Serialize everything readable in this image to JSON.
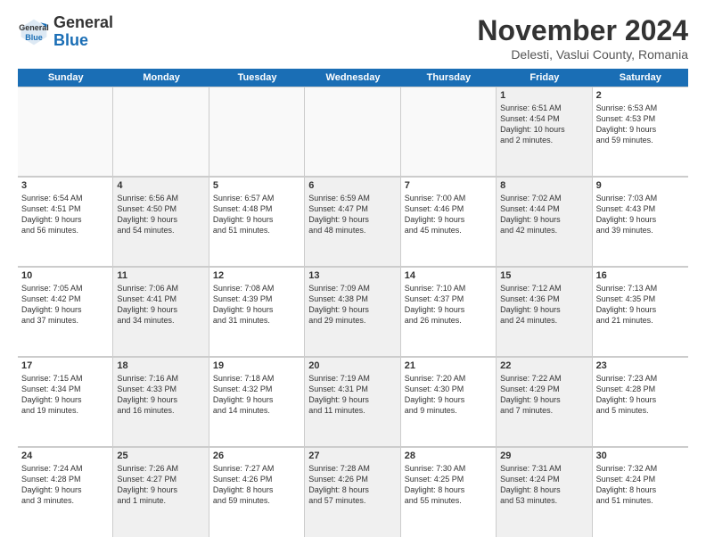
{
  "logo": {
    "line1": "General",
    "line2": "Blue"
  },
  "title": "November 2024",
  "location": "Delesti, Vaslui County, Romania",
  "days_of_week": [
    "Sunday",
    "Monday",
    "Tuesday",
    "Wednesday",
    "Thursday",
    "Friday",
    "Saturday"
  ],
  "weeks": [
    [
      {
        "day": "",
        "info": "",
        "empty": true
      },
      {
        "day": "",
        "info": "",
        "empty": true
      },
      {
        "day": "",
        "info": "",
        "empty": true
      },
      {
        "day": "",
        "info": "",
        "empty": true
      },
      {
        "day": "",
        "info": "",
        "empty": true
      },
      {
        "day": "1",
        "info": "Sunrise: 6:51 AM\nSunset: 4:54 PM\nDaylight: 10 hours\nand 2 minutes.",
        "shaded": true
      },
      {
        "day": "2",
        "info": "Sunrise: 6:53 AM\nSunset: 4:53 PM\nDaylight: 9 hours\nand 59 minutes.",
        "shaded": false
      }
    ],
    [
      {
        "day": "3",
        "info": "Sunrise: 6:54 AM\nSunset: 4:51 PM\nDaylight: 9 hours\nand 56 minutes.",
        "shaded": false
      },
      {
        "day": "4",
        "info": "Sunrise: 6:56 AM\nSunset: 4:50 PM\nDaylight: 9 hours\nand 54 minutes.",
        "shaded": true
      },
      {
        "day": "5",
        "info": "Sunrise: 6:57 AM\nSunset: 4:48 PM\nDaylight: 9 hours\nand 51 minutes.",
        "shaded": false
      },
      {
        "day": "6",
        "info": "Sunrise: 6:59 AM\nSunset: 4:47 PM\nDaylight: 9 hours\nand 48 minutes.",
        "shaded": true
      },
      {
        "day": "7",
        "info": "Sunrise: 7:00 AM\nSunset: 4:46 PM\nDaylight: 9 hours\nand 45 minutes.",
        "shaded": false
      },
      {
        "day": "8",
        "info": "Sunrise: 7:02 AM\nSunset: 4:44 PM\nDaylight: 9 hours\nand 42 minutes.",
        "shaded": true
      },
      {
        "day": "9",
        "info": "Sunrise: 7:03 AM\nSunset: 4:43 PM\nDaylight: 9 hours\nand 39 minutes.",
        "shaded": false
      }
    ],
    [
      {
        "day": "10",
        "info": "Sunrise: 7:05 AM\nSunset: 4:42 PM\nDaylight: 9 hours\nand 37 minutes.",
        "shaded": false
      },
      {
        "day": "11",
        "info": "Sunrise: 7:06 AM\nSunset: 4:41 PM\nDaylight: 9 hours\nand 34 minutes.",
        "shaded": true
      },
      {
        "day": "12",
        "info": "Sunrise: 7:08 AM\nSunset: 4:39 PM\nDaylight: 9 hours\nand 31 minutes.",
        "shaded": false
      },
      {
        "day": "13",
        "info": "Sunrise: 7:09 AM\nSunset: 4:38 PM\nDaylight: 9 hours\nand 29 minutes.",
        "shaded": true
      },
      {
        "day": "14",
        "info": "Sunrise: 7:10 AM\nSunset: 4:37 PM\nDaylight: 9 hours\nand 26 minutes.",
        "shaded": false
      },
      {
        "day": "15",
        "info": "Sunrise: 7:12 AM\nSunset: 4:36 PM\nDaylight: 9 hours\nand 24 minutes.",
        "shaded": true
      },
      {
        "day": "16",
        "info": "Sunrise: 7:13 AM\nSunset: 4:35 PM\nDaylight: 9 hours\nand 21 minutes.",
        "shaded": false
      }
    ],
    [
      {
        "day": "17",
        "info": "Sunrise: 7:15 AM\nSunset: 4:34 PM\nDaylight: 9 hours\nand 19 minutes.",
        "shaded": false
      },
      {
        "day": "18",
        "info": "Sunrise: 7:16 AM\nSunset: 4:33 PM\nDaylight: 9 hours\nand 16 minutes.",
        "shaded": true
      },
      {
        "day": "19",
        "info": "Sunrise: 7:18 AM\nSunset: 4:32 PM\nDaylight: 9 hours\nand 14 minutes.",
        "shaded": false
      },
      {
        "day": "20",
        "info": "Sunrise: 7:19 AM\nSunset: 4:31 PM\nDaylight: 9 hours\nand 11 minutes.",
        "shaded": true
      },
      {
        "day": "21",
        "info": "Sunrise: 7:20 AM\nSunset: 4:30 PM\nDaylight: 9 hours\nand 9 minutes.",
        "shaded": false
      },
      {
        "day": "22",
        "info": "Sunrise: 7:22 AM\nSunset: 4:29 PM\nDaylight: 9 hours\nand 7 minutes.",
        "shaded": true
      },
      {
        "day": "23",
        "info": "Sunrise: 7:23 AM\nSunset: 4:28 PM\nDaylight: 9 hours\nand 5 minutes.",
        "shaded": false
      }
    ],
    [
      {
        "day": "24",
        "info": "Sunrise: 7:24 AM\nSunset: 4:28 PM\nDaylight: 9 hours\nand 3 minutes.",
        "shaded": false
      },
      {
        "day": "25",
        "info": "Sunrise: 7:26 AM\nSunset: 4:27 PM\nDaylight: 9 hours\nand 1 minute.",
        "shaded": true
      },
      {
        "day": "26",
        "info": "Sunrise: 7:27 AM\nSunset: 4:26 PM\nDaylight: 8 hours\nand 59 minutes.",
        "shaded": false
      },
      {
        "day": "27",
        "info": "Sunrise: 7:28 AM\nSunset: 4:26 PM\nDaylight: 8 hours\nand 57 minutes.",
        "shaded": true
      },
      {
        "day": "28",
        "info": "Sunrise: 7:30 AM\nSunset: 4:25 PM\nDaylight: 8 hours\nand 55 minutes.",
        "shaded": false
      },
      {
        "day": "29",
        "info": "Sunrise: 7:31 AM\nSunset: 4:24 PM\nDaylight: 8 hours\nand 53 minutes.",
        "shaded": true
      },
      {
        "day": "30",
        "info": "Sunrise: 7:32 AM\nSunset: 4:24 PM\nDaylight: 8 hours\nand 51 minutes.",
        "shaded": false
      }
    ]
  ]
}
